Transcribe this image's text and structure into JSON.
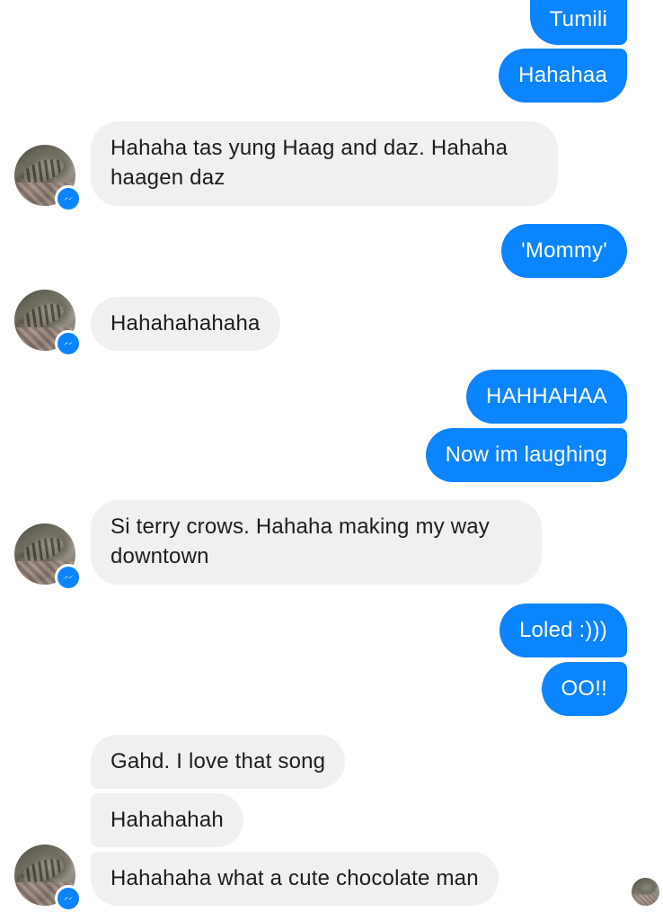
{
  "colors": {
    "outgoing_bubble": "#0a84ff",
    "incoming_bubble": "#f0f0f0",
    "messenger_badge": "#0a84ff"
  },
  "messages": [
    {
      "sender": "me",
      "text": "Tumili"
    },
    {
      "sender": "me",
      "text": "Hahahaa"
    },
    {
      "sender": "contact",
      "text": "Hahaha tas yung Haag and daz. Hahaha haagen daz"
    },
    {
      "sender": "me",
      "text": "'Mommy'"
    },
    {
      "sender": "contact",
      "text": "Hahahahahaha"
    },
    {
      "sender": "me",
      "text": "HAHHAHAA"
    },
    {
      "sender": "me",
      "text": "Now im laughing"
    },
    {
      "sender": "contact",
      "text": "Si terry crows. Hahaha making my way downtown"
    },
    {
      "sender": "me",
      "text": "Loled :)))"
    },
    {
      "sender": "me",
      "text": "OO!!"
    },
    {
      "sender": "contact",
      "text": "Gahd. I love that song"
    },
    {
      "sender": "contact",
      "text": "Hahahahah"
    },
    {
      "sender": "contact",
      "text": "Hahahaha what a cute chocolate man"
    }
  ],
  "icons": {
    "contact_avatar": "cat-photo-avatar",
    "platform_badge": "messenger-icon",
    "read_receipt": "read-receipt-avatar"
  }
}
